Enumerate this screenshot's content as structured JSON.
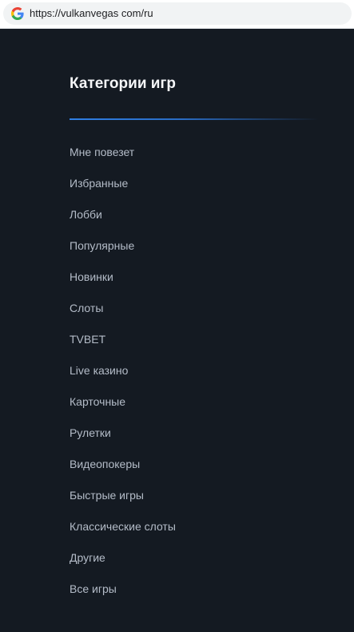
{
  "browser": {
    "url": "https://vulkanvegas com/ru",
    "favicon": "google-g-icon"
  },
  "categories": {
    "title": "Категории игр",
    "accent_color": "#2f7fe5",
    "items": [
      {
        "label": "Мне повезет"
      },
      {
        "label": "Избранные"
      },
      {
        "label": "Лобби"
      },
      {
        "label": "Популярные"
      },
      {
        "label": "Новинки"
      },
      {
        "label": "Слоты"
      },
      {
        "label": "TVBET"
      },
      {
        "label": "Live казино"
      },
      {
        "label": "Карточные"
      },
      {
        "label": "Рулетки"
      },
      {
        "label": "Видеопокеры"
      },
      {
        "label": "Быстрые игры"
      },
      {
        "label": "Классические слоты"
      },
      {
        "label": "Другие"
      },
      {
        "label": "Все игры"
      }
    ]
  }
}
